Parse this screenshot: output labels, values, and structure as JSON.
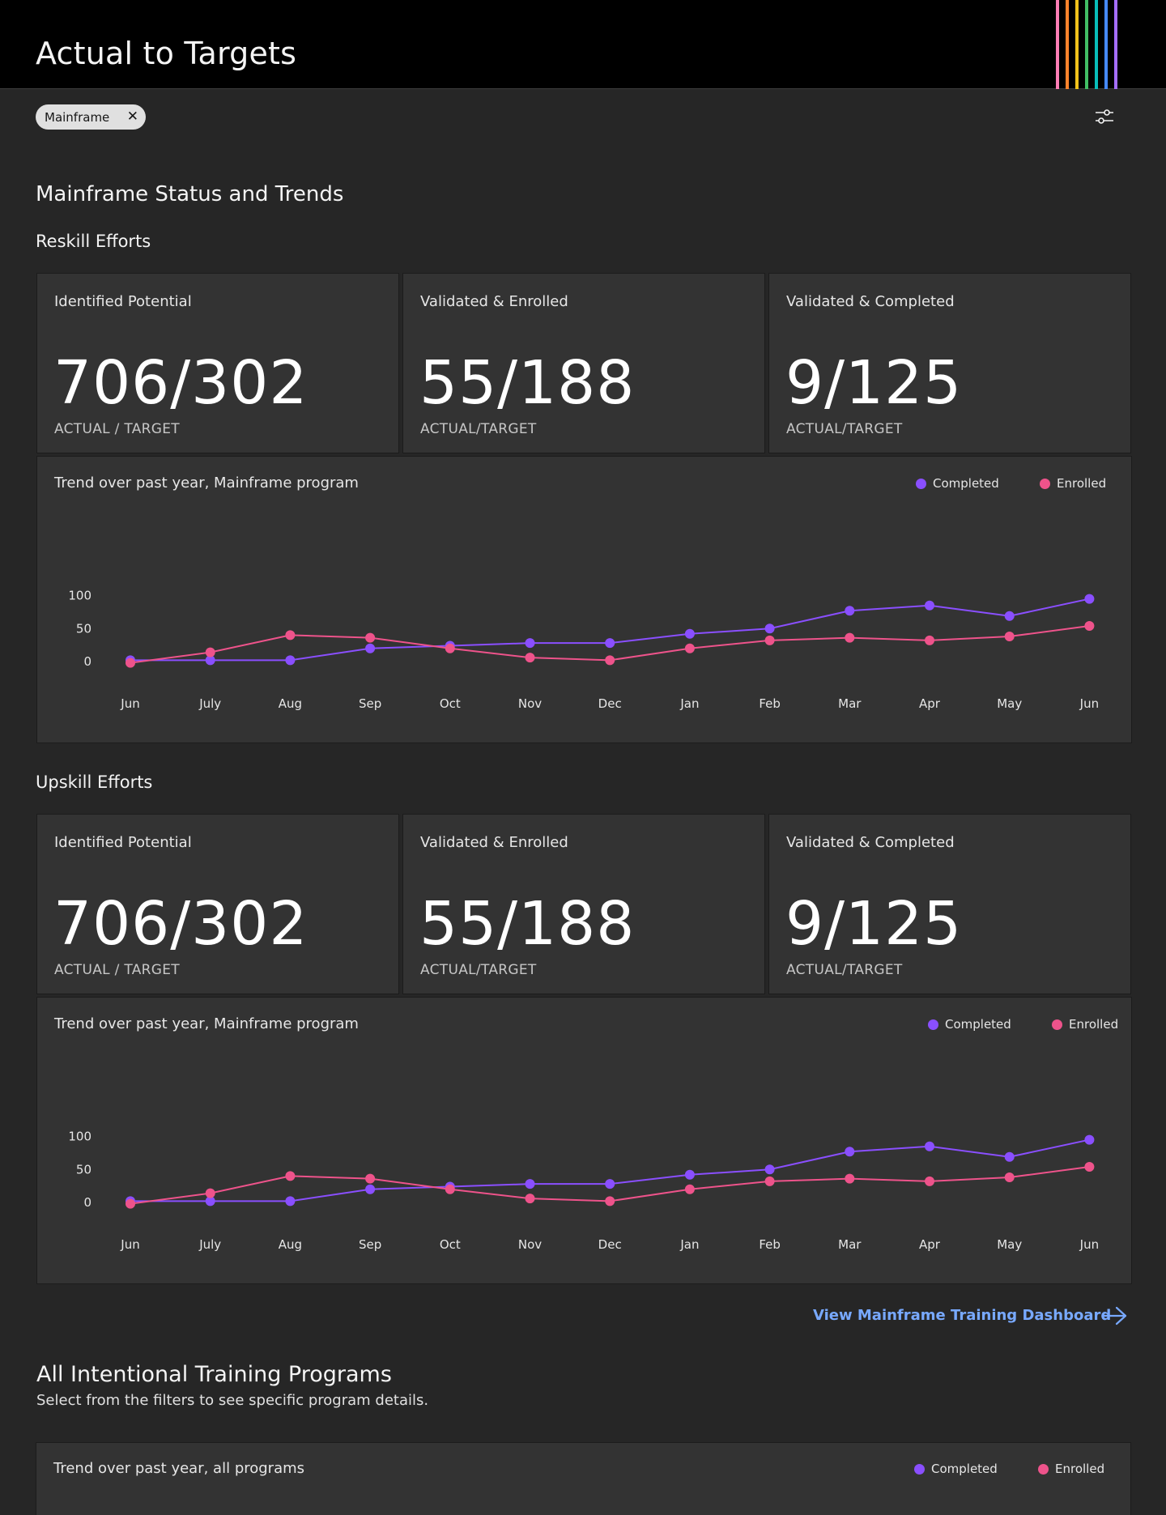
{
  "header": {
    "title": "Actual to Targets"
  },
  "colors": {
    "completed": "#8a4fff",
    "enrolled": "#ee538b",
    "stripes": [
      "#ff7eb6",
      "#ff832b",
      "#f1c21b",
      "#42be65",
      "#08bdba",
      "#4589ff",
      "#a56eff"
    ]
  },
  "filter": {
    "chip_label": "Mainframe",
    "close_glyph": "✕"
  },
  "page": {
    "heading": "Mainframe Status and Trends"
  },
  "reskill": {
    "heading": "Reskill Efforts",
    "cards": [
      {
        "title": "Identified Potential",
        "value": "706/302",
        "sub": "ACTUAL / TARGET"
      },
      {
        "title": "Validated & Enrolled",
        "value": "55/188",
        "sub": "ACTUAL/TARGET"
      },
      {
        "title": "Validated & Completed",
        "value": "9/125",
        "sub": "ACTUAL/TARGET"
      }
    ],
    "chart_title": "Trend over past year, Mainframe program",
    "legend": {
      "completed": "Completed",
      "enrolled": "Enrolled"
    }
  },
  "upskill": {
    "heading": "Upskill Efforts",
    "cards": [
      {
        "title": "Identified Potential",
        "value": "706/302",
        "sub": "ACTUAL / TARGET"
      },
      {
        "title": "Validated & Enrolled",
        "value": "55/188",
        "sub": "ACTUAL/TARGET"
      },
      {
        "title": "Validated & Completed",
        "value": "9/125",
        "sub": "ACTUAL/TARGET"
      }
    ],
    "chart_title": "Trend over past year, Mainframe program",
    "legend": {
      "completed": "Completed",
      "enrolled": "Enrolled"
    }
  },
  "link": {
    "label": "View Mainframe Training Dashboard"
  },
  "all_programs": {
    "heading": "All Intentional Training Programs",
    "description": "Select from the filters to see specific program details.",
    "chart_title": "Trend over past year, all programs",
    "legend": {
      "completed": "Completed",
      "enrolled": "Enrolled"
    }
  },
  "chart_data": [
    {
      "type": "line",
      "categories": [
        "Jun",
        "July",
        "Aug",
        "Sep",
        "Oct",
        "Nov",
        "Dec",
        "Jan",
        "Feb",
        "Mar",
        "Apr",
        "May",
        "Jun"
      ],
      "series": [
        {
          "name": "Completed",
          "values": [
            2,
            2,
            2,
            20,
            24,
            28,
            28,
            42,
            50,
            77,
            85,
            69,
            95
          ]
        },
        {
          "name": "Enrolled",
          "values": [
            -2,
            14,
            40,
            36,
            20,
            6,
            2,
            20,
            32,
            36,
            32,
            38,
            54
          ]
        }
      ],
      "title": "Trend over past year, Mainframe program",
      "yticks": [
        0,
        50,
        100
      ],
      "ylim": [
        0,
        100
      ]
    },
    {
      "type": "line",
      "categories": [
        "Jun",
        "July",
        "Aug",
        "Sep",
        "Oct",
        "Nov",
        "Dec",
        "Jan",
        "Feb",
        "Mar",
        "Apr",
        "May",
        "Jun"
      ],
      "series": [
        {
          "name": "Completed",
          "values": [
            2,
            2,
            2,
            20,
            24,
            28,
            28,
            42,
            50,
            77,
            85,
            69,
            95
          ]
        },
        {
          "name": "Enrolled",
          "values": [
            -2,
            14,
            40,
            36,
            20,
            6,
            2,
            20,
            32,
            36,
            32,
            38,
            54
          ]
        }
      ],
      "title": "Trend over past year, Mainframe program",
      "yticks": [
        0,
        50,
        100
      ],
      "ylim": [
        0,
        100
      ]
    }
  ]
}
